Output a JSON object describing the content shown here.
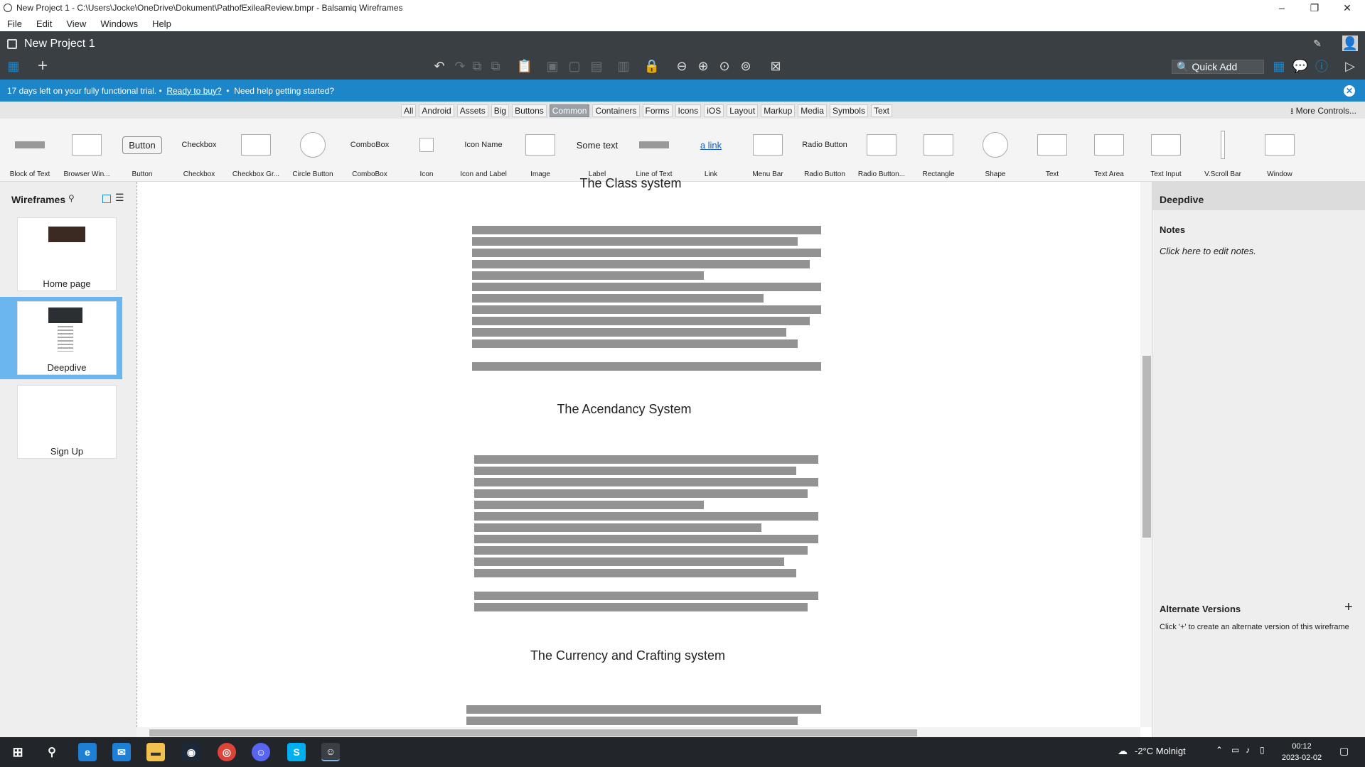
{
  "window": {
    "title": "New Project 1 - C:\\Users\\Jocke\\OneDrive\\Dokument\\PathofExileaReview.bmpr - Balsamiq Wireframes",
    "controls": [
      "–",
      "❐",
      "✕"
    ]
  },
  "menu": [
    "File",
    "Edit",
    "View",
    "Windows",
    "Help"
  ],
  "header": {
    "project_name": "New Project 1",
    "quick_add_placeholder": "Quick Add"
  },
  "trial": {
    "text": "17 days left on your fully functional trial. •",
    "buy_link": "Ready to buy?",
    "sep": "•",
    "help_text": "Need help getting started?"
  },
  "categories": {
    "items": [
      "All",
      "Android",
      "Assets",
      "Big",
      "Buttons",
      "Common",
      "Containers",
      "Forms",
      "Icons",
      "iOS",
      "Layout",
      "Markup",
      "Media",
      "Symbols",
      "Text"
    ],
    "active": "Common",
    "more_label": "More Controls..."
  },
  "palette": {
    "items": [
      {
        "label": "Block of Text",
        "icon": "block-of-text-icon"
      },
      {
        "label": "Browser Win...",
        "icon": "browser-window-icon"
      },
      {
        "label": "Button",
        "icon": "button-icon",
        "preview_text": "Button"
      },
      {
        "label": "Checkbox",
        "icon": "checkbox-icon",
        "preview_text": "Checkbox"
      },
      {
        "label": "Checkbox Gr...",
        "icon": "checkbox-group-icon"
      },
      {
        "label": "Circle Button",
        "icon": "circle-button-icon"
      },
      {
        "label": "ComboBox",
        "icon": "combobox-icon",
        "preview_text": "ComboBox"
      },
      {
        "label": "Icon",
        "icon": "icon-icon"
      },
      {
        "label": "Icon and Label",
        "icon": "icon-and-label-icon",
        "preview_text": "Icon Name"
      },
      {
        "label": "Image",
        "icon": "image-icon"
      },
      {
        "label": "Label",
        "icon": "label-icon",
        "preview_text": "Some text"
      },
      {
        "label": "Line of Text",
        "icon": "line-of-text-icon"
      },
      {
        "label": "Link",
        "icon": "link-icon",
        "preview_text": "a link"
      },
      {
        "label": "Menu Bar",
        "icon": "menu-bar-icon"
      },
      {
        "label": "Radio Button",
        "icon": "radio-button-icon",
        "preview_text": "Radio Button"
      },
      {
        "label": "Radio Button...",
        "icon": "radio-button-group-icon"
      },
      {
        "label": "Rectangle",
        "icon": "rectangle-icon"
      },
      {
        "label": "Shape",
        "icon": "shape-icon"
      },
      {
        "label": "Text",
        "icon": "text-icon"
      },
      {
        "label": "Text Area",
        "icon": "text-area-icon"
      },
      {
        "label": "Text Input",
        "icon": "text-input-icon"
      },
      {
        "label": "V.Scroll Bar",
        "icon": "vscroll-bar-icon"
      },
      {
        "label": "Window",
        "icon": "window-icon"
      }
    ]
  },
  "wireframes": {
    "title": "Wireframes",
    "pages": [
      {
        "name": "Home page",
        "selected": false
      },
      {
        "name": "Deepdive",
        "selected": true
      },
      {
        "name": "Sign Up",
        "selected": false
      }
    ]
  },
  "canvas": {
    "sections": [
      "The Class system",
      "The Acendancy System",
      "The Currency and Crafting system"
    ]
  },
  "inspector": {
    "title": "Deepdive",
    "notes_heading": "Notes",
    "notes_placeholder": "Click here to edit notes.",
    "alt_heading": "Alternate Versions",
    "alt_text": "Click '+' to create an alternate version of this wireframe"
  },
  "taskbar": {
    "weather": "-2°C  Molnigt",
    "time": "00:12",
    "date": "2023-02-02"
  },
  "colors": {
    "header_bg": "#3a3f44",
    "trial_bg": "#1c86c8",
    "selected_page": "#6cb6f0",
    "text_bar": "#929292"
  }
}
